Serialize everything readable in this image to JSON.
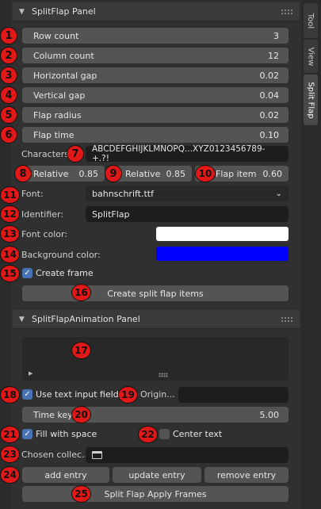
{
  "tabs": [
    {
      "label": "Tool",
      "active": false
    },
    {
      "label": "View",
      "active": false
    },
    {
      "label": "Split Flap",
      "active": true
    }
  ],
  "panel1": {
    "title": "SplitFlap Panel",
    "fields": [
      {
        "label": "Row count",
        "value": "3"
      },
      {
        "label": "Column count",
        "value": "12"
      },
      {
        "label": "Horizontal gap",
        "value": "0.02"
      },
      {
        "label": "Vertical gap",
        "value": "0.04"
      },
      {
        "label": "Flap radius",
        "value": "0.02"
      },
      {
        "label": "Flap time",
        "value": "0.10"
      }
    ],
    "characters_label": "Characters:",
    "characters_value": "ABCDEFGHIJKLMNOPQ...XYZ0123456789-+.?!",
    "relative1_label": "Relative",
    "relative1_value": "0.85",
    "relative2_label": "Relative",
    "relative2_value": "0.85",
    "flap_item_label": "Flap item",
    "flap_item_value": "0.60",
    "font_label": "Font:",
    "font_value": "bahnschrift.ttf",
    "identifier_label": "Identifier:",
    "identifier_value": "SplitFlap",
    "font_color_label": "Font color:",
    "font_color": "#ffffff",
    "bg_color_label": "Background color:",
    "bg_color": "#0000ff",
    "create_frame_label": "Create frame",
    "create_button": "Create split flap items"
  },
  "panel2": {
    "title": "SplitFlapAnimation Panel",
    "use_text_input_label": "Use text input field",
    "origin_label": "Origin...",
    "origin_value": "",
    "time_key_label": "Time key",
    "time_key_value": "5.00",
    "fill_with_space_label": "Fill with space",
    "center_text_label": "Center text",
    "chosen_collection_label": "Chosen collec...",
    "add_entry": "add entry",
    "update_entry": "update entry",
    "remove_entry": "remove entry",
    "apply_frames": "Split Flap Apply Frames"
  },
  "badges": [
    "1",
    "2",
    "3",
    "4",
    "5",
    "6",
    "7",
    "8",
    "9",
    "10",
    "11",
    "12",
    "13",
    "14",
    "15",
    "16",
    "17",
    "18",
    "19",
    "20",
    "21",
    "22",
    "23",
    "24",
    "25"
  ]
}
